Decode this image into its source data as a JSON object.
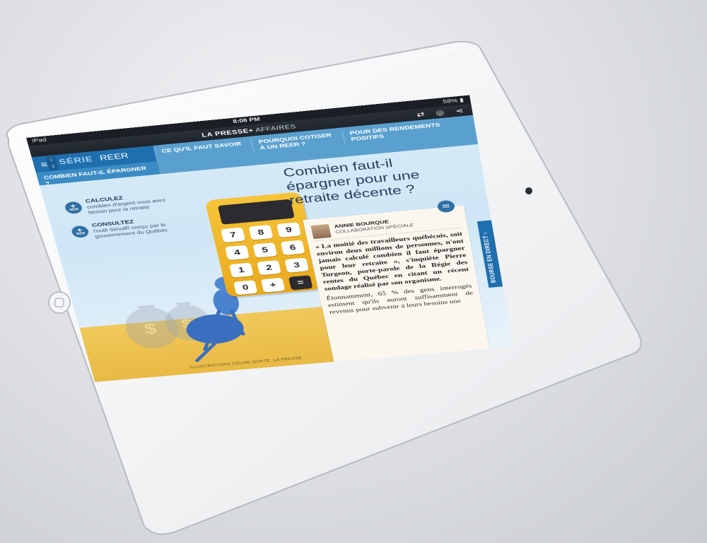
{
  "status_bar": {
    "device": "iPad",
    "time": "8:06 PM",
    "battery": "58%"
  },
  "app_bar": {
    "brand_bold": "LA PRESSE+",
    "brand_section": "AFFAIRES",
    "icons": [
      "rotate-icon",
      "listen-icon",
      "share-icon"
    ]
  },
  "series": {
    "nums": [
      "1",
      "3"
    ],
    "label": "SÉRIE",
    "name": "REER"
  },
  "tabs": [
    {
      "label": "CE QU'IL FAUT SAVOIR"
    },
    {
      "label": "POURQUOI COTISER À UN REER ?"
    },
    {
      "label": "POUR DES RENDEMENTS POSITIFS"
    }
  ],
  "active_tab": {
    "label": "COMBIEN FAUT-IL ÉPARGNER ?"
  },
  "links": [
    {
      "badge": "WEB",
      "title": "CALCULEZ",
      "desc": "combien d'argent vous avez besoin pour la retraite"
    },
    {
      "badge": "WEB",
      "title": "CONSULTEZ",
      "desc": "l'outil SimulR conçu par le gouvernement du Québec"
    }
  ],
  "headline": "Combien faut-il épargner pour une retraite décente ?",
  "author": {
    "name": "ANNIE BOURQUE",
    "role": "COLLABORATION SPÉCIALE"
  },
  "article": {
    "lead": "« La moitié des travailleurs québécois, soit environ deux millions de personnes, n'ont jamais calculé combien il faut épargner pour leur retraite », s'inquiète Pierre Turgeon, porte-parole de la Régie des rentes du Québec en citant un récent sondage réalisé par son organisme.",
    "body": "Étonnamment, 65 % des gens interrogés estiment qu'ils auront suffisamment de revenus pour subvenir à leurs besoins une"
  },
  "live_panel": {
    "label": "BOURSE EN DIRECT"
  },
  "calculator_keys": [
    "7",
    "8",
    "9",
    "4",
    "5",
    "6",
    "1",
    "2",
    "3",
    "0",
    "+",
    "="
  ],
  "credit": "ILLUSTRATIONS CÉLINE BONTE, LA PRESSE"
}
